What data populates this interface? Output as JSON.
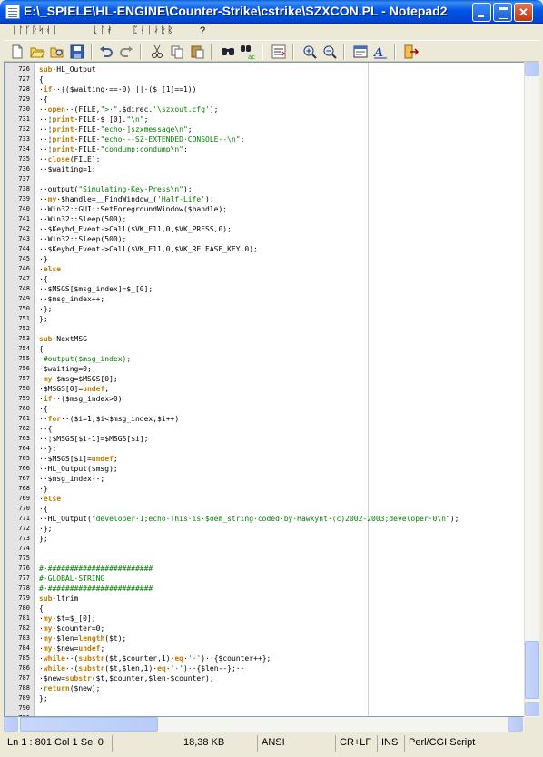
{
  "window": {
    "title": "E:\\_SPIELE\\HL-ENGINE\\Counter-Strike\\cstrike\\SZXCON.PL - Notepad2",
    "minimize_label": "_",
    "maximize_label": "",
    "close_label": "✕"
  },
  "menu": [
    {
      "label": "ᛁᛚᚴᚱ"
    },
    {
      "label": "ᛋᚮᛁ"
    },
    {
      "label": "ᚳᛚᚯ"
    },
    {
      "label": "ᛈᚽᛁᛅᚱᛒ"
    },
    {
      "label": "?"
    }
  ],
  "toolbar": [
    "new-file-icon",
    "open-file-icon",
    "browse-icon",
    "save-icon",
    "undo-icon",
    "redo-icon",
    "cut-icon",
    "copy-icon",
    "paste-icon",
    "find-icon",
    "replace-icon",
    "word-wrap-icon",
    "zoom-in-icon",
    "zoom-out-icon",
    "scheme-icon",
    "font-icon",
    "exit-icon"
  ],
  "colors": {
    "keyword": "#c07a00",
    "variable": "#000000",
    "string": "#008000",
    "comment": "#008000",
    "function": "#000000"
  },
  "lines": [
    {
      "n": "726",
      "t": "sub·HL_Output"
    },
    {
      "n": "727",
      "t": "{"
    },
    {
      "n": "728",
      "t": "·if··(($waiting·==·0)·||·($_[1]==1))"
    },
    {
      "n": "729",
      "t": "·{"
    },
    {
      "n": "730",
      "t": "··open··(FILE,\">·\".$direc.'\\szxout.cfg');"
    },
    {
      "n": "731",
      "t": "··¦print·FILE·$_[0].\"\\n\";"
    },
    {
      "n": "732",
      "t": "··¦print·FILE·\"echo·]szxmessage\\n\";"
    },
    {
      "n": "733",
      "t": "··¦print·FILE·\"echo·--SZ·EXTENDED·CONSOLE--\\n\";"
    },
    {
      "n": "734",
      "t": "··¦print·FILE·\"condump;condump\\n\";"
    },
    {
      "n": "735",
      "t": "··close(FILE);"
    },
    {
      "n": "736",
      "t": "··$waiting=1;"
    },
    {
      "n": "737",
      "t": ""
    },
    {
      "n": "738",
      "t": "··output(\"Simulating·Key·Press\\n\");"
    },
    {
      "n": "739",
      "t": "··my·$handle=__FindWindow_('Half-Life');"
    },
    {
      "n": "740",
      "t": "··Win32::GUI::SetForegroundWindow($handle);"
    },
    {
      "n": "741",
      "t": "··Win32::Sleep(500);"
    },
    {
      "n": "742",
      "t": "··$Keybd_Event->Call($VK_F11,0,$VK_PRESS,0);"
    },
    {
      "n": "743",
      "t": "··Win32::Sleep(500);"
    },
    {
      "n": "744",
      "t": "··$Keybd_Event->Call($VK_F11,0,$VK_RELEASE_KEY,0);"
    },
    {
      "n": "745",
      "t": "·}"
    },
    {
      "n": "746",
      "t": "·else"
    },
    {
      "n": "747",
      "t": "·{"
    },
    {
      "n": "748",
      "t": "··$MSGS[$msg_index]=$_[0];"
    },
    {
      "n": "749",
      "t": "··$msg_index++;"
    },
    {
      "n": "750",
      "t": "·};"
    },
    {
      "n": "751",
      "t": "};"
    },
    {
      "n": "752",
      "t": ""
    },
    {
      "n": "753",
      "t": "sub·NextMSG"
    },
    {
      "n": "754",
      "t": "{"
    },
    {
      "n": "755",
      "t": "·#output($msg_index);"
    },
    {
      "n": "756",
      "t": "·$waiting=0;"
    },
    {
      "n": "757",
      "t": "·my·$msg=$MSGS[0];"
    },
    {
      "n": "758",
      "t": "·$MSGS[0]=undef;"
    },
    {
      "n": "759",
      "t": "·if··($msg_index>0)"
    },
    {
      "n": "760",
      "t": "·{"
    },
    {
      "n": "761",
      "t": "··for··($i=1;$i<$msg_index;$i++)"
    },
    {
      "n": "762",
      "t": "··{"
    },
    {
      "n": "763",
      "t": "··¦$MSGS[$i-1]=$MSGS[$i];"
    },
    {
      "n": "764",
      "t": "··};"
    },
    {
      "n": "765",
      "t": "··$MSGS[$i]=undef;"
    },
    {
      "n": "766",
      "t": "··HL_Output($msg);"
    },
    {
      "n": "767",
      "t": "··$msg_index--;"
    },
    {
      "n": "768",
      "t": "·}"
    },
    {
      "n": "769",
      "t": "·else"
    },
    {
      "n": "770",
      "t": "·{"
    },
    {
      "n": "771",
      "t": "··HL_Output(\"developer·1;echo·This·is·$oem_string·coded·by·Hawkynt·(c)2002-2003;developer·0\\n\");"
    },
    {
      "n": "772",
      "t": "·};"
    },
    {
      "n": "773",
      "t": "};"
    },
    {
      "n": "774",
      "t": ""
    },
    {
      "n": "775",
      "t": ""
    },
    {
      "n": "776",
      "t": "#·########################"
    },
    {
      "n": "777",
      "t": "#·GLOBAL·STRING"
    },
    {
      "n": "778",
      "t": "#·########################"
    },
    {
      "n": "779",
      "t": "sub·ltrim"
    },
    {
      "n": "780",
      "t": "{"
    },
    {
      "n": "781",
      "t": "·my·$t=$_[0];"
    },
    {
      "n": "782",
      "t": "·my·$counter=0;"
    },
    {
      "n": "783",
      "t": "·my·$len=length($t);"
    },
    {
      "n": "784",
      "t": "·my·$new=undef;"
    },
    {
      "n": "785",
      "t": "·while··(substr($t,$counter,1)·eq·'·')··{$counter++};"
    },
    {
      "n": "786",
      "t": "·while··(substr($t,$len,1)·eq·'·')··{$len--};··"
    },
    {
      "n": "787",
      "t": "·$new=substr($t,$counter,$len-$counter);"
    },
    {
      "n": "788",
      "t": "·return($new);"
    },
    {
      "n": "789",
      "t": "};"
    },
    {
      "n": "790",
      "t": ""
    },
    {
      "n": "791",
      "t": "·"
    }
  ],
  "status": {
    "position": "Ln 1 : 801",
    "col": "Col 1",
    "sel": "Sel 0",
    "size": "18,38 KB",
    "encoding": "ANSI",
    "line_ending": "CR+LF",
    "mode": "INS",
    "scheme": "Perl/CGI Script"
  }
}
